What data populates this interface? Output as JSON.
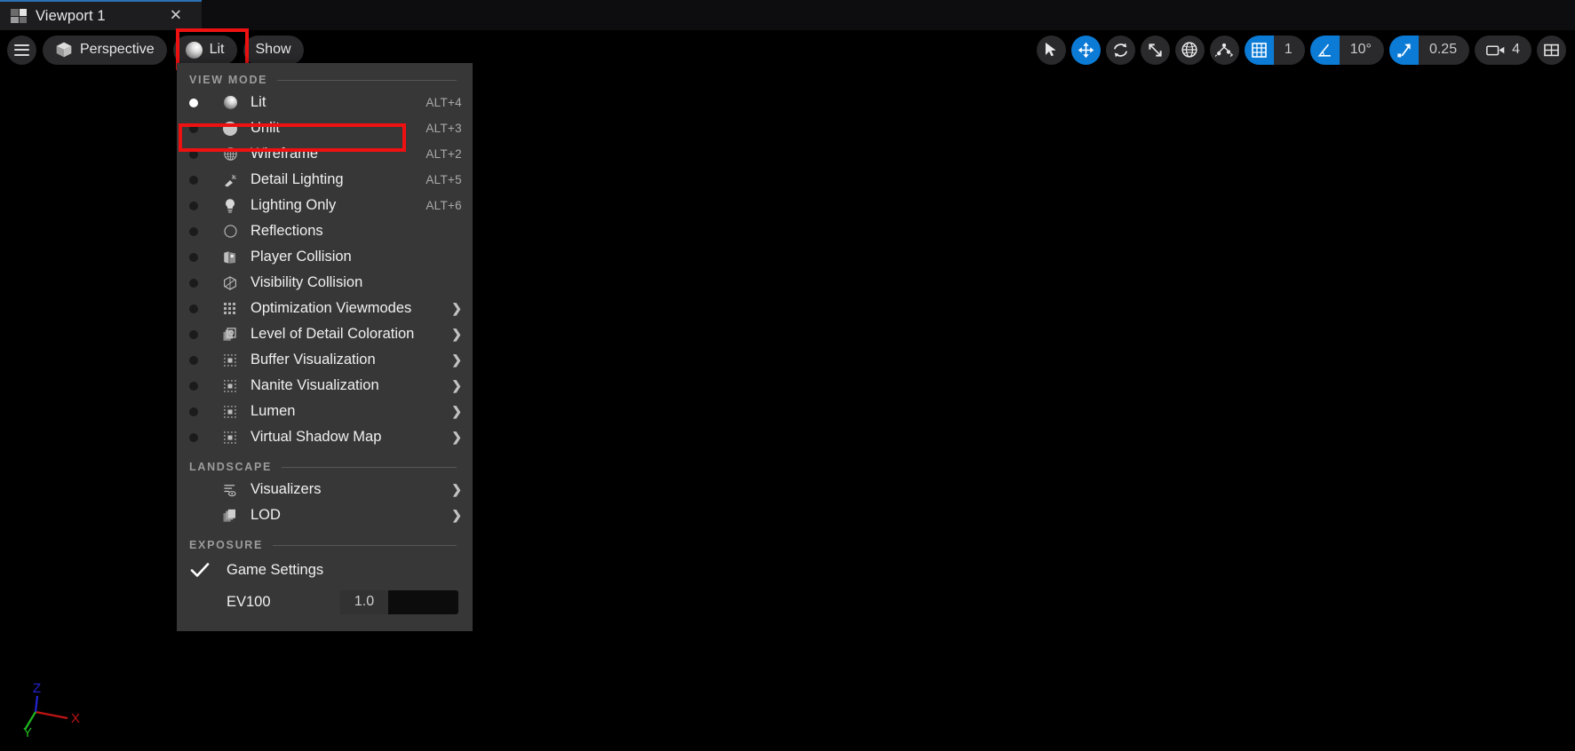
{
  "window": {
    "tab_title": "Viewport 1",
    "tab_icon": "viewport-grid-icon",
    "close_icon": "✕"
  },
  "toolbar_left": {
    "menu_button": {
      "name": "viewport-options-menu",
      "icon": "hamburger-icon"
    },
    "perspective": {
      "label": "Perspective",
      "icon": "cube-icon"
    },
    "view_mode": {
      "label": "Lit",
      "icon": "lit-sphere-icon",
      "highlighted": true
    },
    "show": {
      "label": "Show"
    }
  },
  "toolbar_right": {
    "select_tool": {
      "icon": "cursor-arrow-icon",
      "active": false
    },
    "move_tool": {
      "icon": "move-arrows-icon",
      "active": true
    },
    "rotate_tool": {
      "icon": "rotate-icon",
      "active": false
    },
    "scale_tool": {
      "icon": "scale-icon",
      "active": false
    },
    "coordinate_system": {
      "icon": "globe-icon",
      "active": false
    },
    "surface_snap": {
      "icon": "surface-snap-icon",
      "active": false
    },
    "grid_snap": {
      "icon": "grid-icon",
      "active": true,
      "value": "1"
    },
    "angle_snap": {
      "icon": "angle-icon",
      "active": true,
      "value": "10°"
    },
    "scale_snap": {
      "icon": "scale-arrow-icon",
      "active": true,
      "value": "0.25"
    },
    "camera_speed": {
      "icon": "camera-icon",
      "value": "4"
    },
    "layout": {
      "icon": "viewport-layout-icon"
    }
  },
  "menu": {
    "sections": [
      {
        "label": "VIEW MODE"
      },
      {
        "label": "LANDSCAPE"
      },
      {
        "label": "EXPOSURE"
      }
    ],
    "view_modes": [
      {
        "label": "Lit",
        "shortcut": "ALT+4",
        "icon": "lit-sphere-icon",
        "selected": true,
        "submenu": false
      },
      {
        "label": "Unlit",
        "shortcut": "ALT+3",
        "icon": "unlit-sphere-icon",
        "selected": false,
        "submenu": false,
        "highlighted": true
      },
      {
        "label": "Wireframe",
        "shortcut": "ALT+2",
        "icon": "wireframe-globe-icon",
        "selected": false,
        "submenu": false
      },
      {
        "label": "Detail Lighting",
        "shortcut": "ALT+5",
        "icon": "detail-lighting-icon",
        "selected": false,
        "submenu": false
      },
      {
        "label": "Lighting Only",
        "shortcut": "ALT+6",
        "icon": "lightbulb-icon",
        "selected": false,
        "submenu": false
      },
      {
        "label": "Reflections",
        "shortcut": "",
        "icon": "reflections-icon",
        "selected": false,
        "submenu": false
      },
      {
        "label": "Player Collision",
        "shortcut": "",
        "icon": "player-collision-icon",
        "selected": false,
        "submenu": false
      },
      {
        "label": "Visibility Collision",
        "shortcut": "",
        "icon": "visibility-collision-icon",
        "selected": false,
        "submenu": false
      },
      {
        "label": "Optimization Viewmodes",
        "shortcut": "",
        "icon": "optimization-grid-icon",
        "selected": false,
        "submenu": true
      },
      {
        "label": "Level of Detail Coloration",
        "shortcut": "",
        "icon": "lod-coloration-icon",
        "selected": false,
        "submenu": true
      },
      {
        "label": "Buffer Visualization",
        "shortcut": "",
        "icon": "buffer-viz-icon",
        "selected": false,
        "submenu": true
      },
      {
        "label": "Nanite Visualization",
        "shortcut": "",
        "icon": "nanite-viz-icon",
        "selected": false,
        "submenu": true
      },
      {
        "label": "Lumen",
        "shortcut": "",
        "icon": "lumen-viz-icon",
        "selected": false,
        "submenu": true
      },
      {
        "label": "Virtual Shadow Map",
        "shortcut": "",
        "icon": "vsm-viz-icon",
        "selected": false,
        "submenu": true
      }
    ],
    "landscape": [
      {
        "label": "Visualizers",
        "icon": "visualizers-icon",
        "submenu": true
      },
      {
        "label": "LOD",
        "icon": "lod-icon",
        "submenu": true
      }
    ],
    "exposure": {
      "game_settings": {
        "label": "Game Settings",
        "checked": true,
        "check_icon": "checkmark-icon"
      },
      "ev100": {
        "label": "EV100",
        "value": "1.0"
      }
    },
    "submenu_arrow": "❯"
  },
  "gizmo": {
    "x_label": "X",
    "x_color": "#c01414",
    "y_label": "Y",
    "y_color": "#1fb81f",
    "z_label": "Z",
    "z_color": "#2424d8"
  },
  "colors": {
    "accent_blue": "#0c7bd6",
    "highlight_red": "#ee1111",
    "menu_bg": "#373737",
    "viewport_bg": "#000000"
  }
}
